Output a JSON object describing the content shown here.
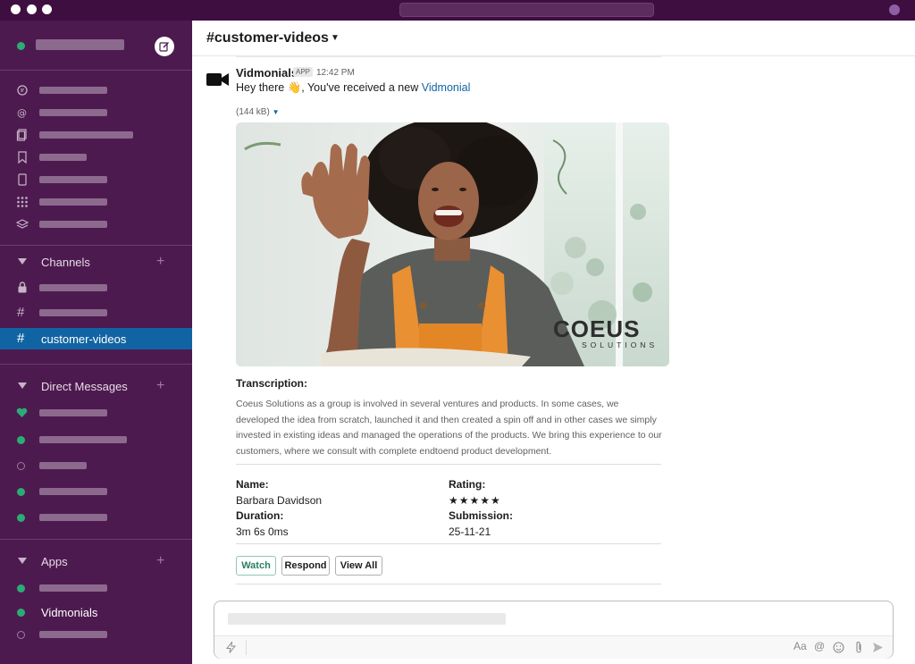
{
  "channel": {
    "name": "customer-videos"
  },
  "sidebar": {
    "sections": {
      "channels": {
        "label": "Channels"
      },
      "direct_messages": {
        "label": "Direct Messages"
      },
      "apps": {
        "label": "Apps"
      }
    },
    "active_channel": "customer-videos",
    "apps_item": "Vidmonials"
  },
  "message": {
    "sender": "Vidmonials",
    "badge": "APP",
    "time": "12:42 PM",
    "greeting": "Hey there",
    "wave": "👋",
    "text": ", You've received a new",
    "link": "Vidmonial",
    "file_size": "(144 kB)",
    "video_logo_main": "COEUS",
    "video_logo_sub": "SOLUTIONS",
    "transcription_label": "Transcription:",
    "transcription_text": "Coeus Solutions as a group is involved in several ventures and products. In some cases, we developed the idea from scratch, launched it and then created a spin off and in other cases we simply invested in existing ideas and managed the operations of the products. We bring this experience to our customers, where we consult with complete endtoend product development.",
    "fields": {
      "name_label": "Name:",
      "name_value": "Barbara Davidson",
      "rating_label": "Rating:",
      "rating_value": "★★★★★",
      "rating_stars": 5,
      "duration_label": "Duration:",
      "duration_value": "3m 6s 0ms",
      "submission_label": "Submission:",
      "submission_value": "25-11-21"
    },
    "buttons": {
      "watch": "Watch",
      "respond": "Respond",
      "view_all": "View All"
    }
  },
  "composer": {
    "format_label": "Aa",
    "mention_label": "@"
  },
  "colors": {
    "sidebar": "#4d1a4f",
    "titlebar": "#3f0e40",
    "active": "#1164a3",
    "presence": "#2bac76",
    "link": "#1264a3"
  }
}
